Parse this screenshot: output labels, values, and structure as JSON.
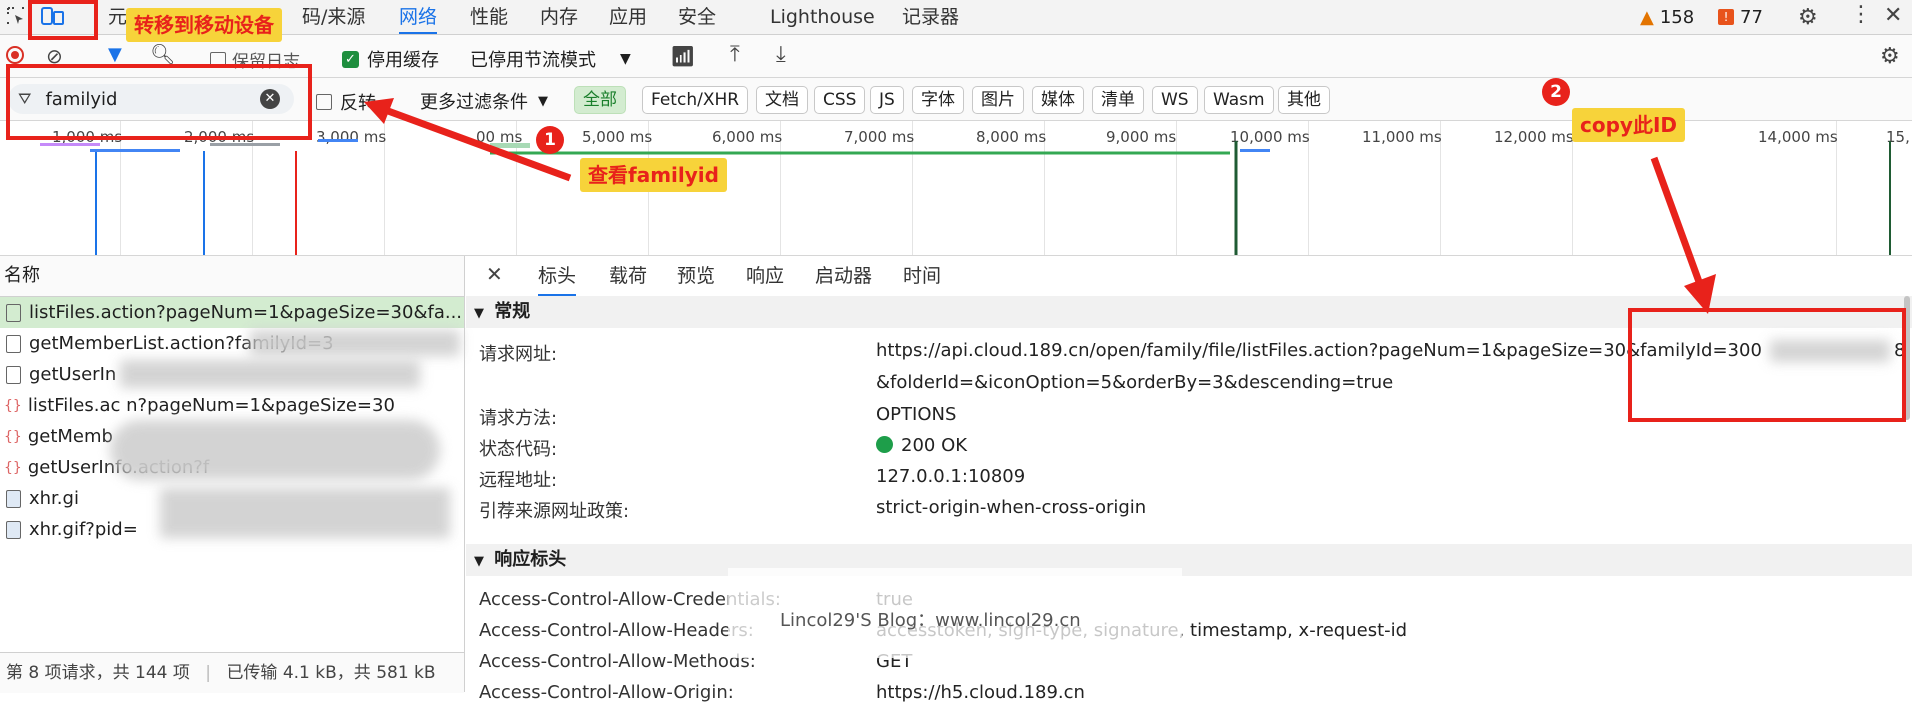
{
  "topbar": {
    "tabs": [
      "元",
      "码/来源",
      "网络",
      "性能",
      "内存",
      "应用",
      "安全",
      "Lighthouse",
      "记录器"
    ],
    "active_tab": "网络",
    "warnings_count": "158",
    "issues_count": "77"
  },
  "toolbar": {
    "preserve_log": "保留日志",
    "disable_cache": "停用缓存",
    "throttling": "已停用节流模式"
  },
  "filterbar": {
    "filter_value": "familyid",
    "invert": "反转",
    "more_filters": "更多过滤条件",
    "chips": [
      "全部",
      "Fetch/XHR",
      "文档",
      "CSS",
      "JS",
      "字体",
      "图片",
      "媒体",
      "清单",
      "WS",
      "Wasm",
      "其他"
    ],
    "active_chip": "全部"
  },
  "overview": {
    "ticks": [
      "1,000 ms",
      "2,000 ms",
      "3,000 ms",
      "00 ms",
      "5,000 ms",
      "6,000 ms",
      "7,000 ms",
      "8,000 ms",
      "9,000 ms",
      "10,000 ms",
      "11,000 ms",
      "12,000 ms",
      "14,000 ms",
      "15,"
    ]
  },
  "list": {
    "header": "名称",
    "items": [
      {
        "name": "listFiles.action?pageNum=1&pageSize=30&fa...",
        "type": "doc"
      },
      {
        "name": "getMemberList.action?familyId=3",
        "type": "doc"
      },
      {
        "name": "getUserIn",
        "type": "doc"
      },
      {
        "name": "listFiles.ac   n?pageNum=1&pageSize=30",
        "type": "fetch"
      },
      {
        "name": "getMemb",
        "type": "fetch"
      },
      {
        "name": "getUserInfo.action?f",
        "type": "fetch"
      },
      {
        "name": "xhr.gi",
        "type": "img"
      },
      {
        "name": "xhr.gif?pid=",
        "type": "img"
      }
    ],
    "status": "第 8 项请求，共 144 项",
    "transfer": "已传输 4.1 kB，共 581 kB"
  },
  "detail": {
    "tabs": [
      "标头",
      "载荷",
      "预览",
      "响应",
      "启动器",
      "时间"
    ],
    "active_tab": "标头",
    "general_title": "常规",
    "general": [
      {
        "key": "请求网址:",
        "value": "https://api.cloud.189.cn/open/family/file/listFiles.action?pageNum=1&pageSize=30&familyId=300"
      },
      {
        "key": "",
        "value": "&folderId=&iconOption=5&orderBy=3&descending=true"
      },
      {
        "key": "请求方法:",
        "value": "OPTIONS"
      },
      {
        "key": "状态代码:",
        "value": "200 OK"
      },
      {
        "key": "远程地址:",
        "value": "127.0.0.1:10809"
      },
      {
        "key": "引荐来源网址政策:",
        "value": "strict-origin-when-cross-origin"
      }
    ],
    "url_tail": "8",
    "response_title": "响应标头",
    "response": [
      {
        "key": "Access-Control-Allow-Credentials:",
        "value": "true"
      },
      {
        "key": "Access-Control-Allow-Headers:",
        "value": "accesstoken, sign-type, signature, timestamp, x-request-id"
      },
      {
        "key": "Access-Control-Allow-Methods:",
        "value": "GET"
      },
      {
        "key": "Access-Control-Allow-Origin:",
        "value": "https://h5.cloud.189.cn"
      }
    ]
  },
  "annotations": {
    "device_mode": "转移到移动设备",
    "view_familyid": "查看familyid",
    "copy_id": "copy此ID",
    "badge1": "1",
    "badge2": "2",
    "watermark": "Lincol29'S Blog：www.lincol29.cn"
  },
  "colors": {
    "accent": "#1a73e8",
    "annotation_red": "#e8221b",
    "annotation_yellow": "#f7d33a",
    "status_green": "#1e9e4a"
  }
}
